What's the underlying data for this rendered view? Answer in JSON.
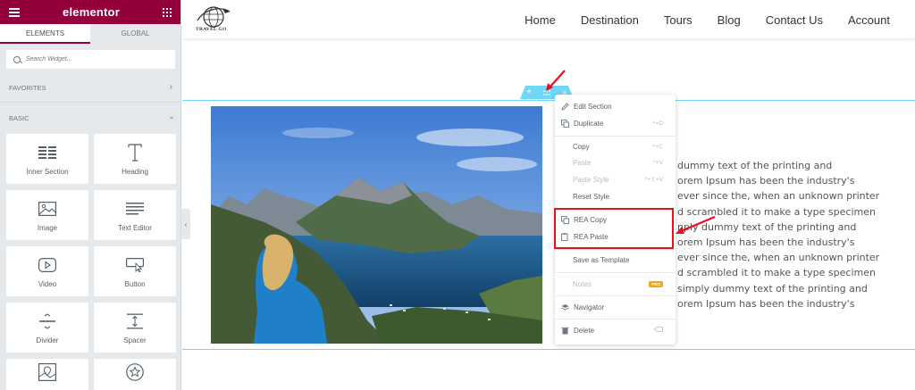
{
  "panel": {
    "brand": "elementor",
    "tabs": [
      {
        "label": "ELEMENTS",
        "active": true
      },
      {
        "label": "GLOBAL",
        "active": false
      }
    ],
    "search_placeholder": "Search Widget...",
    "categories": {
      "favorites": "FAVORITES",
      "basic": "BASIC"
    },
    "widgets": [
      {
        "label": "Inner Section",
        "icon": "columns-icon"
      },
      {
        "label": "Heading",
        "icon": "heading-icon"
      },
      {
        "label": "Image",
        "icon": "image-icon"
      },
      {
        "label": "Text Editor",
        "icon": "text-editor-icon"
      },
      {
        "label": "Video",
        "icon": "video-icon"
      },
      {
        "label": "Button",
        "icon": "button-icon"
      },
      {
        "label": "Divider",
        "icon": "divider-icon"
      },
      {
        "label": "Spacer",
        "icon": "spacer-icon"
      },
      {
        "label": "",
        "icon": "map-icon"
      },
      {
        "label": "",
        "icon": "star-icon"
      }
    ],
    "accent_color": "#93003c"
  },
  "site": {
    "logo_text": "TRAVEL GO",
    "nav": [
      "Home",
      "Destination",
      "Tours",
      "Blog",
      "Contact Us",
      "Account"
    ],
    "body_lines": [
      "dummy text of the printing and",
      "orem Ipsum has been the industry's",
      "ever since the, when an unknown printer",
      "d scrambled it to make a type specimen",
      "nply dummy text of the printing and",
      "orem Ipsum has been the industry's",
      "ever since the, when an unknown printer",
      "d scrambled it to make a type specimen",
      "simply dummy text of the printing and",
      "orem Ipsum has been the industry's"
    ],
    "outline_color": "#71d7f7"
  },
  "context_menu": {
    "items": {
      "edit_section": "Edit Section",
      "duplicate": "Duplicate",
      "duplicate_shortcut": "^+D",
      "copy": "Copy",
      "copy_shortcut": "^+C",
      "paste": "Paste",
      "paste_shortcut": "^+V",
      "paste_style": "Paste Style",
      "paste_style_shortcut": "^+⇧+V",
      "reset_style": "Reset Style",
      "rea_copy": "REA Copy",
      "rea_paste": "REA Paste",
      "save_as_template": "Save as Template",
      "notes": "Notes",
      "notes_badge": "PRO",
      "navigator": "Navigator",
      "delete": "Delete"
    },
    "highlight_color": "#e8101a"
  }
}
